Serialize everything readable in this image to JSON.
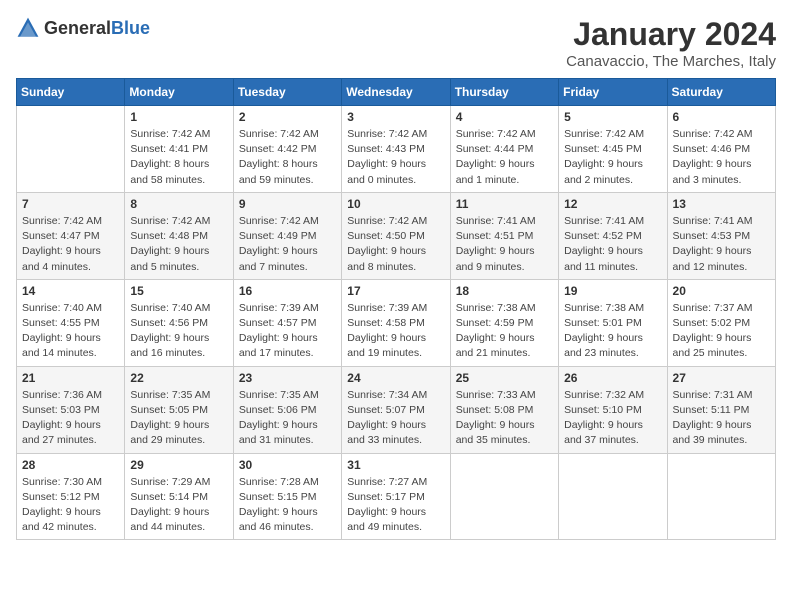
{
  "logo": {
    "general": "General",
    "blue": "Blue"
  },
  "header": {
    "title": "January 2024",
    "subtitle": "Canavaccio, The Marches, Italy"
  },
  "days_of_week": [
    "Sunday",
    "Monday",
    "Tuesday",
    "Wednesday",
    "Thursday",
    "Friday",
    "Saturday"
  ],
  "weeks": [
    [
      {
        "day": "",
        "info": ""
      },
      {
        "day": "1",
        "info": "Sunrise: 7:42 AM\nSunset: 4:41 PM\nDaylight: 8 hours\nand 58 minutes."
      },
      {
        "day": "2",
        "info": "Sunrise: 7:42 AM\nSunset: 4:42 PM\nDaylight: 8 hours\nand 59 minutes."
      },
      {
        "day": "3",
        "info": "Sunrise: 7:42 AM\nSunset: 4:43 PM\nDaylight: 9 hours\nand 0 minutes."
      },
      {
        "day": "4",
        "info": "Sunrise: 7:42 AM\nSunset: 4:44 PM\nDaylight: 9 hours\nand 1 minute."
      },
      {
        "day": "5",
        "info": "Sunrise: 7:42 AM\nSunset: 4:45 PM\nDaylight: 9 hours\nand 2 minutes."
      },
      {
        "day": "6",
        "info": "Sunrise: 7:42 AM\nSunset: 4:46 PM\nDaylight: 9 hours\nand 3 minutes."
      }
    ],
    [
      {
        "day": "7",
        "info": "Sunrise: 7:42 AM\nSunset: 4:47 PM\nDaylight: 9 hours\nand 4 minutes."
      },
      {
        "day": "8",
        "info": "Sunrise: 7:42 AM\nSunset: 4:48 PM\nDaylight: 9 hours\nand 5 minutes."
      },
      {
        "day": "9",
        "info": "Sunrise: 7:42 AM\nSunset: 4:49 PM\nDaylight: 9 hours\nand 7 minutes."
      },
      {
        "day": "10",
        "info": "Sunrise: 7:42 AM\nSunset: 4:50 PM\nDaylight: 9 hours\nand 8 minutes."
      },
      {
        "day": "11",
        "info": "Sunrise: 7:41 AM\nSunset: 4:51 PM\nDaylight: 9 hours\nand 9 minutes."
      },
      {
        "day": "12",
        "info": "Sunrise: 7:41 AM\nSunset: 4:52 PM\nDaylight: 9 hours\nand 11 minutes."
      },
      {
        "day": "13",
        "info": "Sunrise: 7:41 AM\nSunset: 4:53 PM\nDaylight: 9 hours\nand 12 minutes."
      }
    ],
    [
      {
        "day": "14",
        "info": "Sunrise: 7:40 AM\nSunset: 4:55 PM\nDaylight: 9 hours\nand 14 minutes."
      },
      {
        "day": "15",
        "info": "Sunrise: 7:40 AM\nSunset: 4:56 PM\nDaylight: 9 hours\nand 16 minutes."
      },
      {
        "day": "16",
        "info": "Sunrise: 7:39 AM\nSunset: 4:57 PM\nDaylight: 9 hours\nand 17 minutes."
      },
      {
        "day": "17",
        "info": "Sunrise: 7:39 AM\nSunset: 4:58 PM\nDaylight: 9 hours\nand 19 minutes."
      },
      {
        "day": "18",
        "info": "Sunrise: 7:38 AM\nSunset: 4:59 PM\nDaylight: 9 hours\nand 21 minutes."
      },
      {
        "day": "19",
        "info": "Sunrise: 7:38 AM\nSunset: 5:01 PM\nDaylight: 9 hours\nand 23 minutes."
      },
      {
        "day": "20",
        "info": "Sunrise: 7:37 AM\nSunset: 5:02 PM\nDaylight: 9 hours\nand 25 minutes."
      }
    ],
    [
      {
        "day": "21",
        "info": "Sunrise: 7:36 AM\nSunset: 5:03 PM\nDaylight: 9 hours\nand 27 minutes."
      },
      {
        "day": "22",
        "info": "Sunrise: 7:35 AM\nSunset: 5:05 PM\nDaylight: 9 hours\nand 29 minutes."
      },
      {
        "day": "23",
        "info": "Sunrise: 7:35 AM\nSunset: 5:06 PM\nDaylight: 9 hours\nand 31 minutes."
      },
      {
        "day": "24",
        "info": "Sunrise: 7:34 AM\nSunset: 5:07 PM\nDaylight: 9 hours\nand 33 minutes."
      },
      {
        "day": "25",
        "info": "Sunrise: 7:33 AM\nSunset: 5:08 PM\nDaylight: 9 hours\nand 35 minutes."
      },
      {
        "day": "26",
        "info": "Sunrise: 7:32 AM\nSunset: 5:10 PM\nDaylight: 9 hours\nand 37 minutes."
      },
      {
        "day": "27",
        "info": "Sunrise: 7:31 AM\nSunset: 5:11 PM\nDaylight: 9 hours\nand 39 minutes."
      }
    ],
    [
      {
        "day": "28",
        "info": "Sunrise: 7:30 AM\nSunset: 5:12 PM\nDaylight: 9 hours\nand 42 minutes."
      },
      {
        "day": "29",
        "info": "Sunrise: 7:29 AM\nSunset: 5:14 PM\nDaylight: 9 hours\nand 44 minutes."
      },
      {
        "day": "30",
        "info": "Sunrise: 7:28 AM\nSunset: 5:15 PM\nDaylight: 9 hours\nand 46 minutes."
      },
      {
        "day": "31",
        "info": "Sunrise: 7:27 AM\nSunset: 5:17 PM\nDaylight: 9 hours\nand 49 minutes."
      },
      {
        "day": "",
        "info": ""
      },
      {
        "day": "",
        "info": ""
      },
      {
        "day": "",
        "info": ""
      }
    ]
  ]
}
